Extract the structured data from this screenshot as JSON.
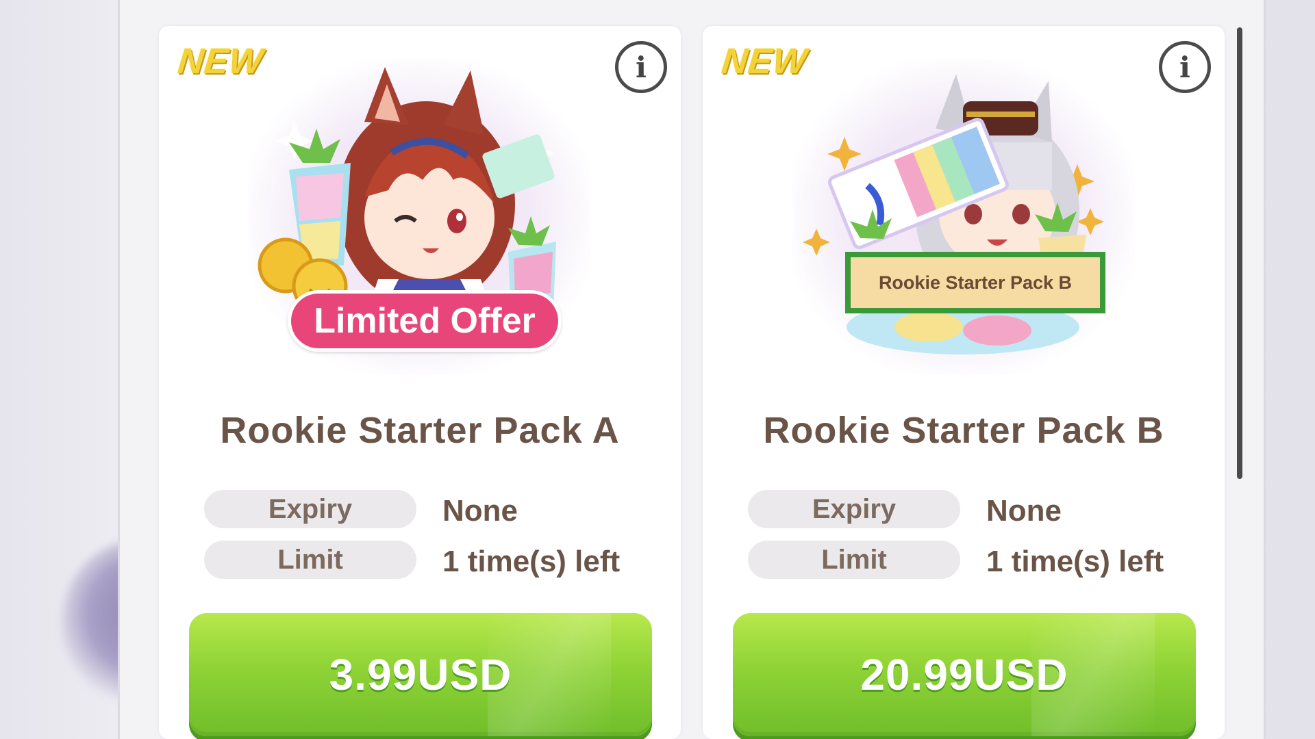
{
  "cards": [
    {
      "badge": "NEW",
      "info_icon": "info-icon",
      "art_label": "Limited Offer",
      "title": "Rookie Starter Pack A",
      "rows": [
        {
          "label": "Expiry",
          "value": "None"
        },
        {
          "label": "Limit",
          "value": "1 time(s) left"
        }
      ],
      "price": "3.99USD"
    },
    {
      "badge": "NEW",
      "info_icon": "info-icon",
      "art_label": "Rookie Starter Pack B",
      "title": "Rookie Starter Pack B",
      "rows": [
        {
          "label": "Expiry",
          "value": "None"
        },
        {
          "label": "Limit",
          "value": "1 time(s) left"
        }
      ],
      "price": "20.99USD"
    }
  ],
  "colors": {
    "buy_button": "#8fd336",
    "limited_badge": "#e8467b",
    "new_badge": "#f3d33a",
    "title_text": "#6a5447"
  }
}
